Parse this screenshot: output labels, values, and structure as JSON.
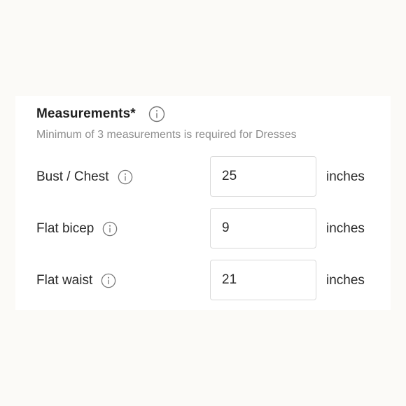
{
  "section": {
    "title": "Measurements*",
    "subtitle": "Minimum of 3 measurements is required for Dresses"
  },
  "measurements": [
    {
      "label": "Bust / Chest",
      "value": "25",
      "unit": "inches"
    },
    {
      "label": "Flat bicep",
      "value": "9",
      "unit": "inches"
    },
    {
      "label": "Flat waist",
      "value": "21",
      "unit": "inches"
    }
  ],
  "icons": {
    "info": "info-icon"
  },
  "colors": {
    "title": "#1f1f1f",
    "subtitle": "#8e8e8e",
    "border": "#d9d9d9",
    "background": "#fbfaf7"
  }
}
